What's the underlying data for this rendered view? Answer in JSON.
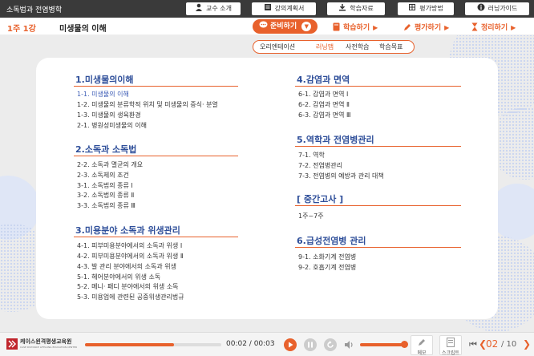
{
  "topbar": {
    "course_title": "소독법과 전염병학",
    "buttons": [
      {
        "label": "교수 소개",
        "icon": "person-icon"
      },
      {
        "label": "강의계획서",
        "icon": "document-icon"
      },
      {
        "label": "학습자료",
        "icon": "download-icon"
      },
      {
        "label": "평가방법",
        "icon": "grid-icon"
      },
      {
        "label": "러닝가이드",
        "icon": "info-icon"
      }
    ]
  },
  "header": {
    "lesson_num": "1주 1강",
    "lesson_title": "미생물의 이해",
    "prep_label": "준비하기",
    "nav": [
      "학습하기",
      "평가하기",
      "정리하기"
    ]
  },
  "submenu": [
    "오리엔테이션",
    "러닝맵",
    "사전학습",
    "학습목표"
  ],
  "colors": {
    "accent": "#e8612c",
    "heading": "#2f4f9a",
    "active": "#3b5bb5"
  },
  "left_sections": [
    {
      "title": "1.미생물의이해",
      "items": [
        "1-1. 미생물의 이해",
        "1-2. 미생물의 분류학적 위치 및 미생물의 증식· 분열",
        "1-3. 미생물의 생육환경",
        "2-1. 병원성미생물의 이해"
      ]
    },
    {
      "title": "2.소독과 소독법",
      "items": [
        "2-2. 소독과 멸균의 개요",
        "2-3. 소독제의 조건",
        "3-1. 소독법의 종류 Ⅰ",
        "3-2. 소독법의 종류 Ⅱ",
        "3-3. 소독법의 종류 Ⅲ"
      ]
    },
    {
      "title": "3.미용분야 소독과 위생관리",
      "items": [
        "4-1. 피부미용분야에서의 소독과 위생 Ⅰ",
        "4-2. 피부미용분야에서의 소독과 위생 Ⅱ",
        "4-3. 발 관리 분야에서의 소독과 위생",
        "5-1. 헤어분야에서의 위생 소독",
        "5-2. 메니· 패디 분야에서의 위생 소독",
        "5-3. 미용업에 관련된 공중위생관리법규"
      ]
    }
  ],
  "right_sections": [
    {
      "title": "4.감염과 면역",
      "items": [
        "6-1. 감염과 면역 Ⅰ",
        "6-2. 감염과 면역 Ⅱ",
        "6-3. 감염과 면역 Ⅲ"
      ]
    },
    {
      "title": "5.역학과 전염병관리",
      "items": [
        "7-1. 역학",
        "7-2. 전염병관리",
        "7-3. 전염병의 예방과 관리 대책"
      ]
    },
    {
      "title": "[ 중간고사 ]",
      "items": [
        "1주~7주"
      ]
    },
    {
      "title": "6.급성전염병 관리",
      "items": [
        "9-1. 소화기계 전염병",
        "9-2. 호흡기계 전염병"
      ]
    }
  ],
  "player": {
    "logo_text": "케이스윈격평생교육원",
    "logo_sub": "CASE DISTANCE LIFELONG EDUCATION CENTER",
    "time": "00:02 / 00:03",
    "progress": 0.65,
    "volume": 0.85,
    "memo_label": "메모",
    "script_label": "스크립트",
    "page_current": "02",
    "page_total": "/ 10"
  }
}
